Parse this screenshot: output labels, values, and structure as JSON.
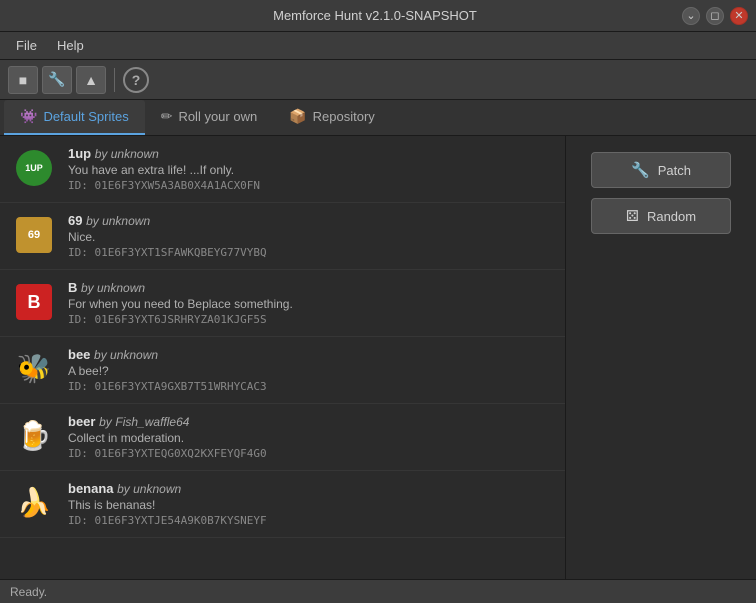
{
  "titleBar": {
    "title": "Memforce Hunt v2.1.0-SNAPSHOT"
  },
  "menuBar": {
    "items": [
      {
        "id": "file",
        "label": "File"
      },
      {
        "id": "help",
        "label": "Help"
      }
    ]
  },
  "toolbar": {
    "buttons": [
      {
        "id": "layout-btn",
        "icon": "▣",
        "label": "Layout"
      },
      {
        "id": "wrench-btn",
        "icon": "🔧",
        "label": "Wrench"
      },
      {
        "id": "upload-btn",
        "icon": "▲",
        "label": "Upload"
      }
    ]
  },
  "tabs": [
    {
      "id": "default-sprites",
      "label": "Default Sprites",
      "icon": "👾",
      "active": true
    },
    {
      "id": "roll-your-own",
      "label": "Roll your own",
      "icon": "✏️",
      "active": false
    },
    {
      "id": "repository",
      "label": "Repository",
      "icon": "📦",
      "active": false
    }
  ],
  "sprites": [
    {
      "id": "1up",
      "name": "1up",
      "author": "unknown",
      "description": "You have an extra life! ...If only.",
      "spriteId": "01E6F3YXW5A3AB0X4A1ACX0FN",
      "iconType": "1up"
    },
    {
      "id": "69",
      "name": "69",
      "author": "unknown",
      "description": "Nice.",
      "spriteId": "01E6F3YXT1SFAWKQBEYG77VYBQ",
      "iconType": "69"
    },
    {
      "id": "b",
      "name": "B",
      "author": "unknown",
      "description": "For when you need to Beplace something.",
      "spriteId": "01E6F3YXT6JSRHRYZA01KJGF5S",
      "iconType": "b"
    },
    {
      "id": "bee",
      "name": "bee",
      "author": "unknown",
      "description": "A bee!?",
      "spriteId": "01E6F3YXTA9GXB7T51WRHYCAC3",
      "iconType": "bee",
      "emoji": "🐝"
    },
    {
      "id": "beer",
      "name": "beer",
      "author": "Fish_waffle64",
      "description": "Collect in moderation.",
      "spriteId": "01E6F3YXTEQG0XQ2KXFEYQF4G0",
      "iconType": "beer",
      "emoji": "🍺"
    },
    {
      "id": "benana",
      "name": "benana",
      "author": "unknown",
      "description": "This is benanas!",
      "spriteId": "01E6F3YXTJE54A9K0B7KYSNEYF",
      "iconType": "benana",
      "emoji": "🍌"
    }
  ],
  "rightPanel": {
    "patchButton": "Patch",
    "randomButton": "Random"
  },
  "statusBar": {
    "text": "Ready."
  },
  "labels": {
    "by": "by",
    "idPrefix": "ID:"
  }
}
